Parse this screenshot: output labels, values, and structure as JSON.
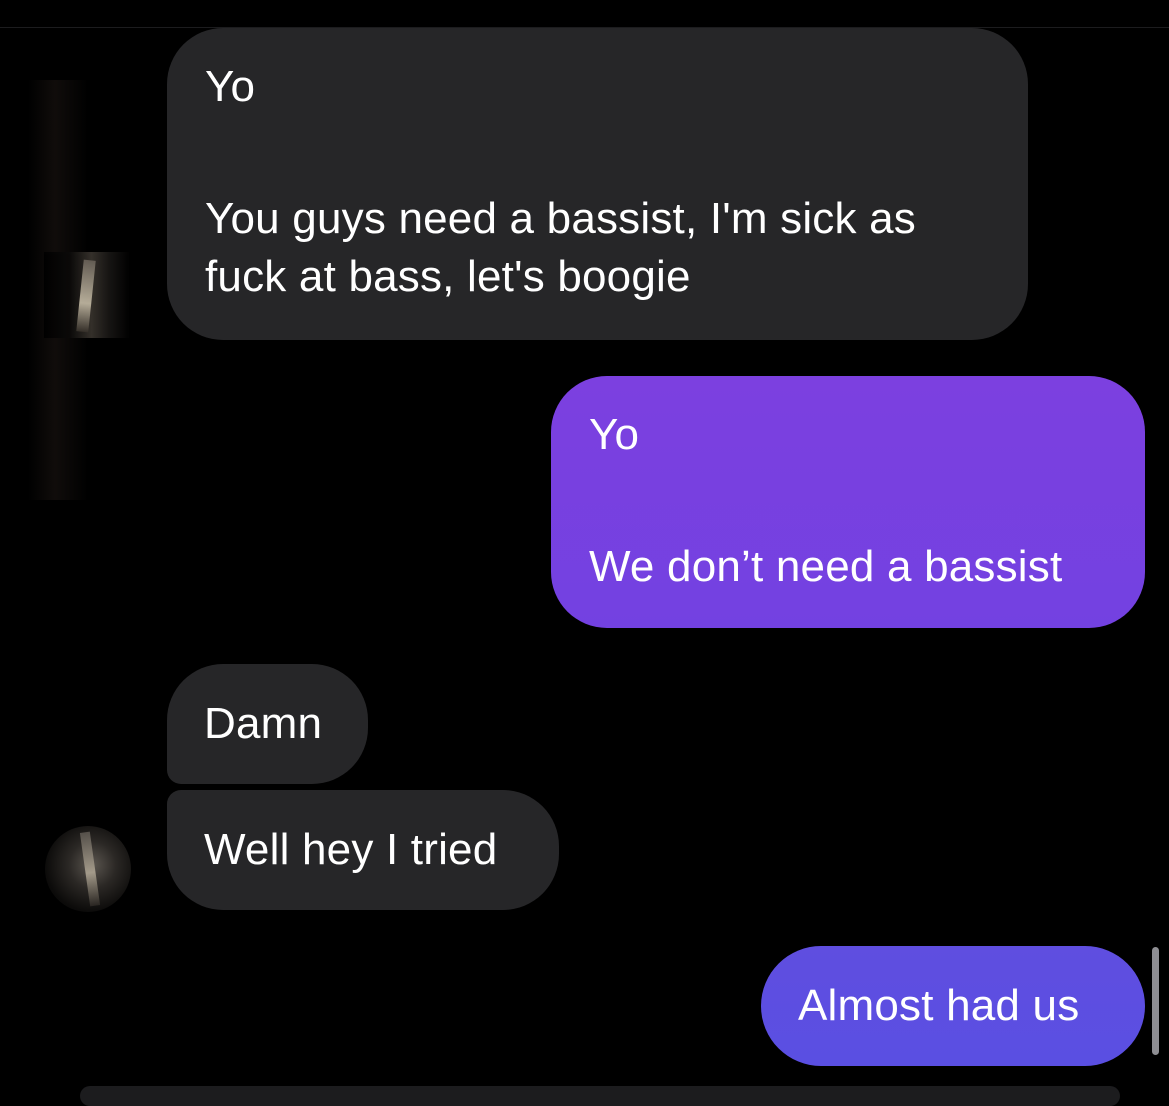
{
  "messages": [
    {
      "id": "msg-1",
      "direction": "incoming",
      "lines": [
        "Yo",
        "",
        "You guys need a bassist, I'm sick as",
        "fuck at bass, let's boogie"
      ]
    },
    {
      "id": "msg-2",
      "direction": "outgoing",
      "lines": [
        "Yo",
        "",
        "We don’t need a bassist"
      ]
    },
    {
      "id": "msg-3",
      "direction": "incoming",
      "lines": [
        "Damn"
      ]
    },
    {
      "id": "msg-4",
      "direction": "incoming",
      "lines": [
        "Well hey I tried"
      ]
    },
    {
      "id": "msg-5",
      "direction": "outgoing",
      "lines": [
        "Almost had us"
      ]
    }
  ],
  "colors": {
    "background": "#000000",
    "incoming_bubble": "#262628",
    "outgoing_bubble": "#7a42e0",
    "outgoing_bubble_last": "#5c4fe1",
    "text": "#ffffff",
    "scrollbar": "#8e8e93"
  },
  "icons": {
    "avatar_1": "contact-avatar-icon",
    "avatar_2": "contact-avatar-icon"
  }
}
